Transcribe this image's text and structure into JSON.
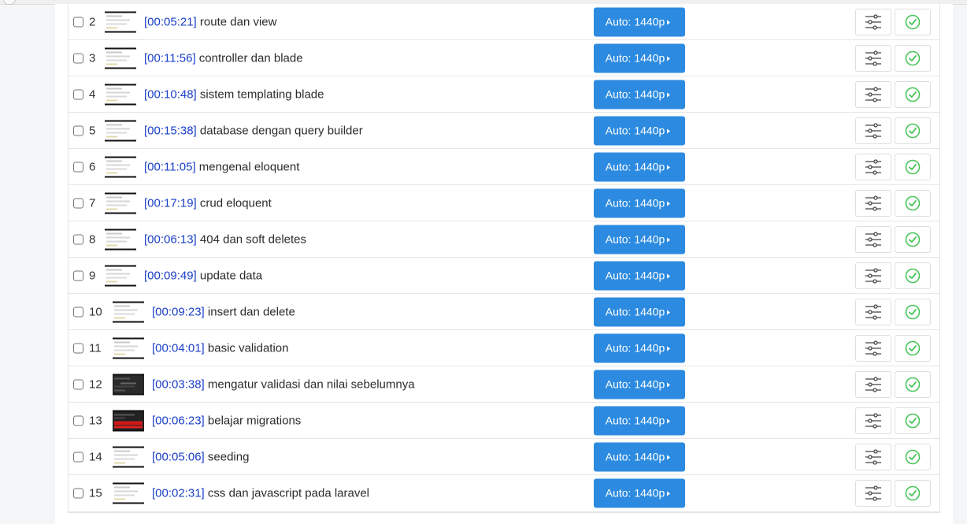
{
  "quality_label": "Auto: 1440p",
  "colors": {
    "duration": "#1a3fc8",
    "quality_button": "#2c8be0",
    "check": "#4bc55b"
  },
  "icons": {
    "settings": "sliders-icon",
    "done": "check-circle-icon",
    "quality_caret": "caret-right-icon"
  },
  "videos": [
    {
      "num": "2",
      "duration": "[00:05:21]",
      "title": "route dan view",
      "thumb": "light"
    },
    {
      "num": "3",
      "duration": "[00:11:56]",
      "title": "controller dan blade",
      "thumb": "light"
    },
    {
      "num": "4",
      "duration": "[00:10:48]",
      "title": "sistem templating blade",
      "thumb": "light"
    },
    {
      "num": "5",
      "duration": "[00:15:38]",
      "title": "database dengan query builder",
      "thumb": "light"
    },
    {
      "num": "6",
      "duration": "[00:11:05]",
      "title": "mengenal eloquent",
      "thumb": "light"
    },
    {
      "num": "7",
      "duration": "[00:17:19]",
      "title": "crud eloquent",
      "thumb": "light"
    },
    {
      "num": "8",
      "duration": "[00:06:13]",
      "title": "404 dan soft deletes",
      "thumb": "light"
    },
    {
      "num": "9",
      "duration": "[00:09:49]",
      "title": "update data",
      "thumb": "light"
    },
    {
      "num": "10",
      "duration": "[00:09:23]",
      "title": "insert dan delete",
      "thumb": "light"
    },
    {
      "num": "11",
      "duration": "[00:04:01]",
      "title": "basic validation",
      "thumb": "light"
    },
    {
      "num": "12",
      "duration": "[00:03:38]",
      "title": "mengatur validasi dan nilai sebelumnya",
      "thumb": "dark"
    },
    {
      "num": "13",
      "duration": "[00:06:23]",
      "title": "belajar migrations",
      "thumb": "red"
    },
    {
      "num": "14",
      "duration": "[00:05:06]",
      "title": "seeding",
      "thumb": "light"
    },
    {
      "num": "15",
      "duration": "[00:02:31]",
      "title": "css dan javascript pada laravel",
      "thumb": "light"
    }
  ]
}
